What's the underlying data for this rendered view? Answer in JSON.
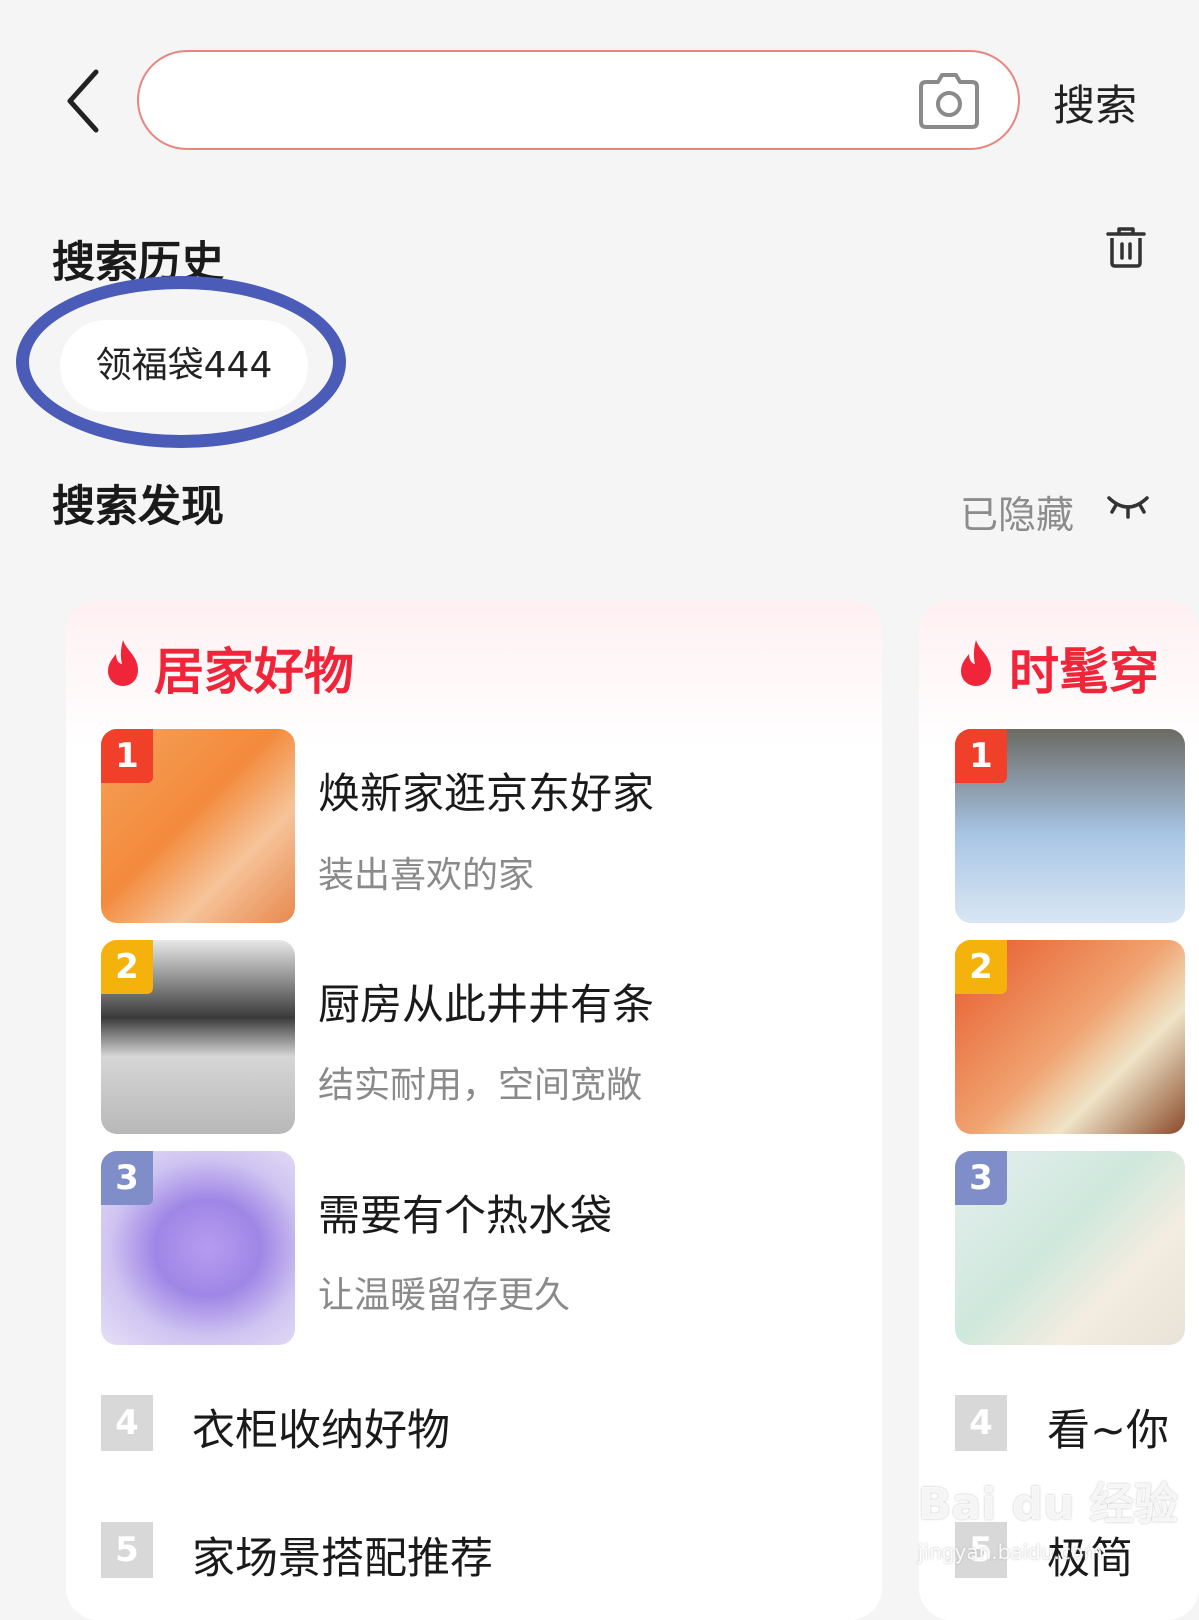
{
  "search": {
    "placeholder": "",
    "button_label": "搜索"
  },
  "history": {
    "title": "搜索历史",
    "items": [
      "领福袋444"
    ]
  },
  "discover": {
    "title": "搜索发现",
    "hidden_label": "已隐藏"
  },
  "cards": [
    {
      "title": "居家好物",
      "items": [
        {
          "rank": "1",
          "title": "焕新家逛京东好家",
          "subtitle": "装出喜欢的家"
        },
        {
          "rank": "2",
          "title": "厨房从此井井有条",
          "subtitle": "结实耐用，空间宽敞"
        },
        {
          "rank": "3",
          "title": "需要有个热水袋",
          "subtitle": "让温暖留存更久"
        },
        {
          "rank": "4",
          "title": "衣柜收纳好物"
        },
        {
          "rank": "5",
          "title": "家场景搭配推荐"
        }
      ]
    },
    {
      "title": "时髦穿",
      "items": [
        {
          "rank": "1"
        },
        {
          "rank": "2"
        },
        {
          "rank": "3"
        },
        {
          "rank": "4",
          "title": "看~你"
        },
        {
          "rank": "5",
          "title": "极简"
        }
      ]
    }
  ],
  "watermark": {
    "brand": "Bai du 经验",
    "url": "jingyan.baidu.com"
  },
  "colors": {
    "accent": "#f0253a",
    "search_border": "#e9857f",
    "annotation": "#4a5bb8"
  },
  "icons": [
    "back-arrow-icon",
    "camera-icon",
    "trash-icon",
    "eye-closed-icon",
    "flame-icon"
  ]
}
